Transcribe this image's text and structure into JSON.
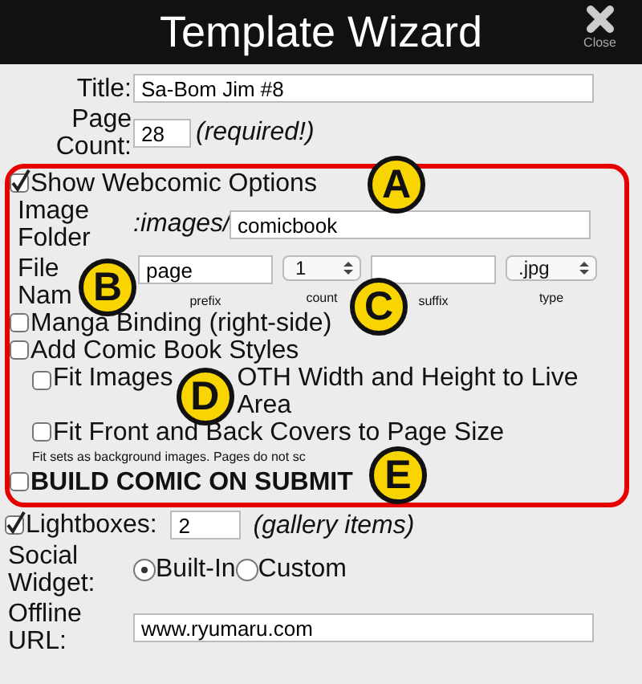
{
  "header": {
    "title": "Template Wizard",
    "close_label": "Close"
  },
  "title_field": {
    "label": "Title:",
    "value": "Sa-Bom Jim #8"
  },
  "page_count": {
    "label": "Page Count:",
    "value": "28",
    "hint": "(required!)"
  },
  "webcomic": {
    "show": {
      "label": "Show Webcomic Options",
      "checked": true
    },
    "image_folder": {
      "label": "Image Folder",
      "path": ":images/",
      "value": "comicbook",
      "callout": "A"
    },
    "file_name": {
      "label": "File Nam",
      "callout": "B",
      "parts": [
        {
          "kind": "text",
          "value": "page",
          "caption": "prefix"
        },
        {
          "kind": "select",
          "value": "1",
          "caption": "count"
        },
        {
          "kind": "text",
          "caption": "suffix"
        },
        {
          "kind": "select",
          "value": ".jpg",
          "caption": "type"
        }
      ]
    },
    "options": [
      {
        "kind": "check",
        "label": "Manga Binding (right-side)",
        "checked": false,
        "callout": "C"
      },
      {
        "kind": "check",
        "label": "Add Comic Book Styles",
        "checked": false,
        "children": [
          {
            "kind": "check",
            "label": "Fit Images",
            "label_after": "OTH Width and Height to Live Area",
            "checked": false,
            "callout": "D"
          },
          {
            "kind": "check",
            "label": "Fit Front and Back Covers to Page Size",
            "checked": false
          }
        ]
      },
      {
        "kind": "note",
        "label": "Fit sets as background images. Pages do not sc"
      },
      {
        "kind": "strong",
        "label": "BUILD COMIC ON SUBMIT",
        "checked": false,
        "callout": "E"
      }
    ]
  },
  "lightboxes": {
    "label": "Lightboxes:",
    "checked": true,
    "value": "2",
    "hint": "(gallery items)"
  },
  "social": {
    "label": "Social Widget:",
    "options": [
      {
        "label": "Built-In",
        "selected": true
      },
      {
        "label": "Custom",
        "selected": false
      }
    ]
  },
  "offline": {
    "label": "Offline URL:",
    "value": "www.ryumaru.com"
  }
}
